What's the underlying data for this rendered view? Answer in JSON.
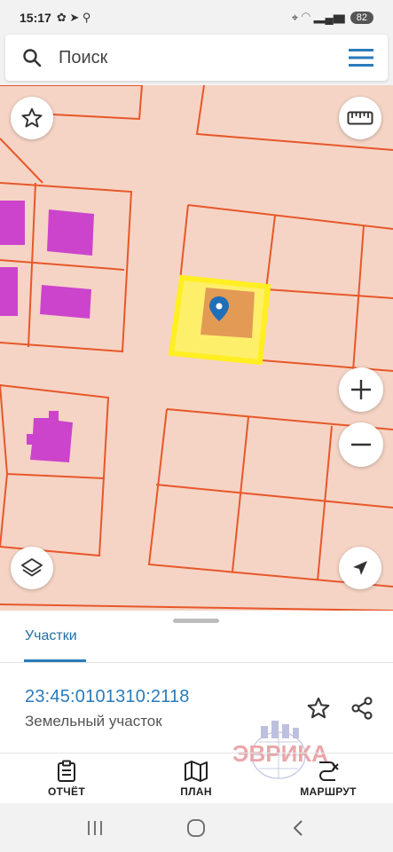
{
  "status_bar": {
    "time": "15:17",
    "battery": "82"
  },
  "search": {
    "placeholder": "Поиск"
  },
  "map_controls": {
    "favorites_icon": "star-icon",
    "ruler_icon": "ruler-icon",
    "zoom_in": "+",
    "zoom_out": "−",
    "layers_icon": "layers-icon",
    "locate_icon": "navigation-arrow-icon"
  },
  "sheet": {
    "tab_label": "Участки",
    "cadastral_number": "23:45:0101310:2118",
    "parcel_type": "Земельный участок",
    "watermark_text": "ЭВРИКА"
  },
  "bottom_nav": [
    {
      "label": "ОТЧЁТ",
      "icon": "report-clipboard-icon"
    },
    {
      "label": "ПЛАН",
      "icon": "map-plan-icon"
    },
    {
      "label": "МАРШРУТ",
      "icon": "route-icon"
    }
  ],
  "colors": {
    "map_background": "#f5d4c5",
    "parcel_border": "#e8572a",
    "building_fill": "#cc44cc",
    "selection": "#ffee22",
    "accent": "#2b7bb9"
  }
}
